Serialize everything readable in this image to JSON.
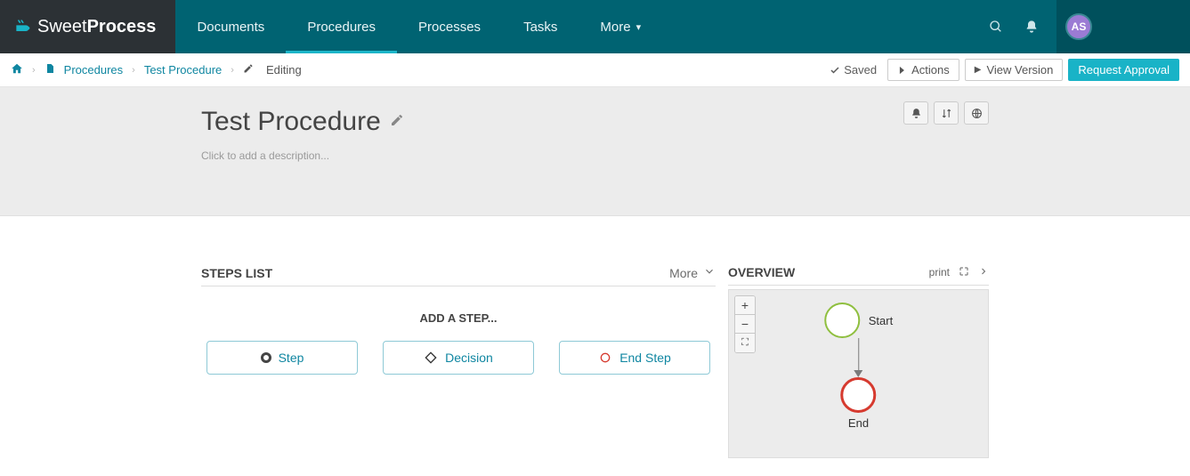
{
  "brand": {
    "prefix": "Sweet",
    "bold": "Process"
  },
  "nav": {
    "items": [
      {
        "label": "Documents"
      },
      {
        "label": "Procedures",
        "active": true
      },
      {
        "label": "Processes"
      },
      {
        "label": "Tasks"
      },
      {
        "label": "More",
        "dropdown": true
      }
    ]
  },
  "user": {
    "initials": "AS"
  },
  "breadcrumb": {
    "procedures": "Procedures",
    "item": "Test Procedure",
    "editing": "Editing"
  },
  "subbar": {
    "saved": "Saved",
    "actions": "Actions",
    "viewVersion": "View Version",
    "requestApproval": "Request Approval"
  },
  "procedure": {
    "title": "Test Procedure",
    "descPlaceholder": "Click to add a description..."
  },
  "stepsList": {
    "header": "STEPS LIST",
    "more": "More"
  },
  "addStep": {
    "header": "ADD A STEP...",
    "step": "Step",
    "decision": "Decision",
    "endStep": "End Step"
  },
  "overview": {
    "header": "OVERVIEW",
    "print": "print",
    "startLabel": "Start",
    "endLabel": "End"
  }
}
